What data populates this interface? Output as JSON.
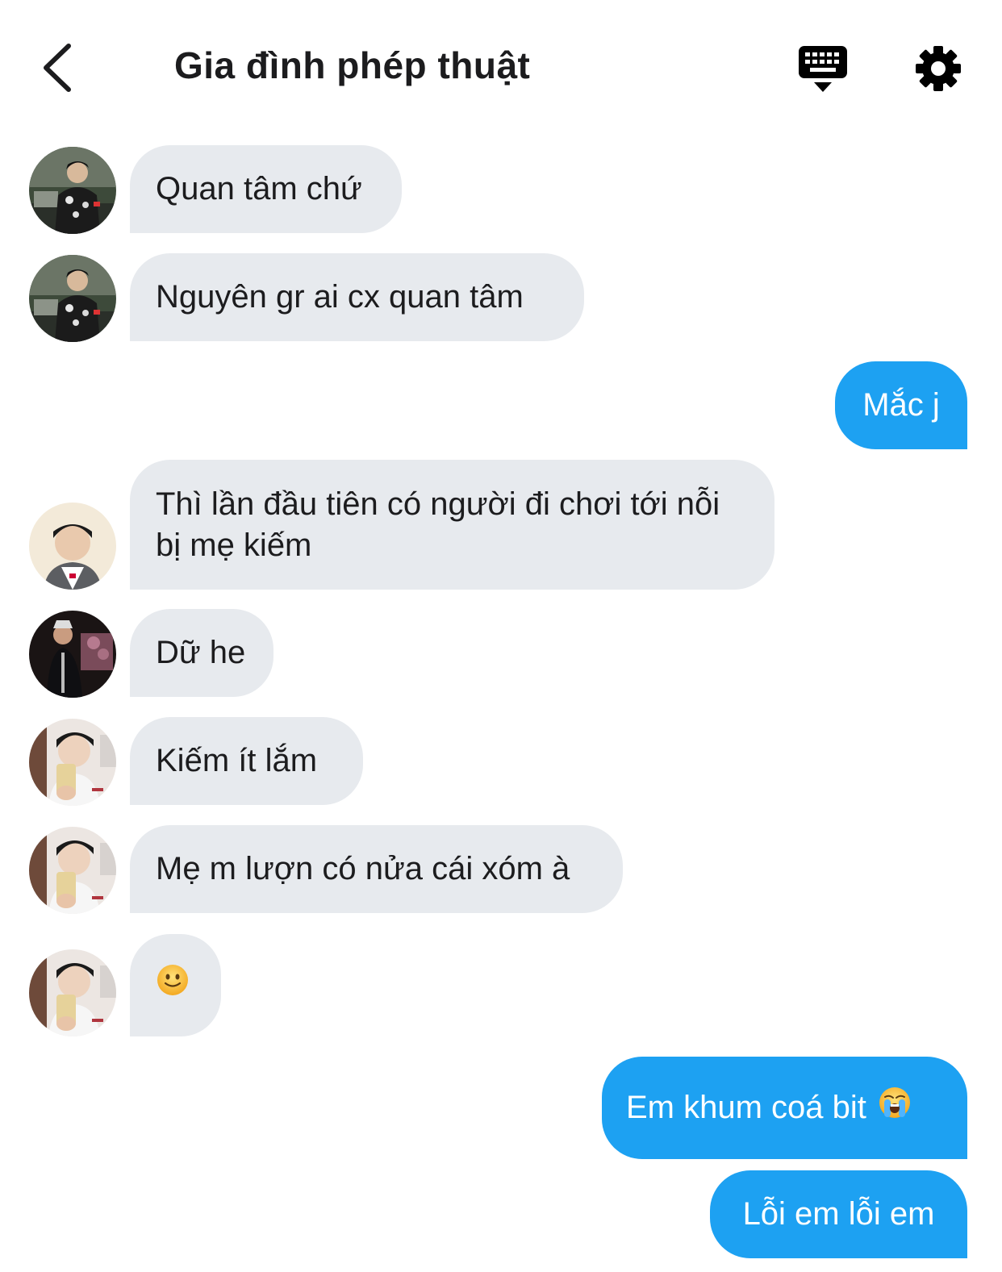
{
  "header": {
    "title": "Gia đình phép thuật",
    "back_icon": "chevron-left-icon",
    "keyboard_icon": "keyboard-icon",
    "settings_icon": "gear-icon"
  },
  "colors": {
    "incoming_bubble": "#e7eaee",
    "outgoing_bubble": "#1da1f2",
    "text_dark": "#1c1c1e"
  },
  "messages": [
    {
      "sender": "other",
      "avatar": "avatar-1",
      "text": "Quan tâm chứ"
    },
    {
      "sender": "other",
      "avatar": "avatar-1",
      "text": "Nguyên gr ai cx quan tâm"
    },
    {
      "sender": "me",
      "text": "Mắc j"
    },
    {
      "sender": "other",
      "avatar": "avatar-2",
      "text": "Thì lần đầu tiên có người đi chơi tới nỗi bị mẹ kiếm"
    },
    {
      "sender": "other",
      "avatar": "avatar-3",
      "text": "Dữ he"
    },
    {
      "sender": "other",
      "avatar": "avatar-4",
      "text": "Kiếm ít lắm"
    },
    {
      "sender": "other",
      "avatar": "avatar-4",
      "text": "Mẹ m lượn có nửa cái xóm à"
    },
    {
      "sender": "other",
      "avatar": "avatar-4",
      "text": "",
      "emoji": "slightly-smiling-face-emoji"
    },
    {
      "sender": "me",
      "text": "Em khum coá bit",
      "emoji": "loudly-crying-face-emoji"
    },
    {
      "sender": "me",
      "text": "Lỗi em lỗi em"
    }
  ]
}
